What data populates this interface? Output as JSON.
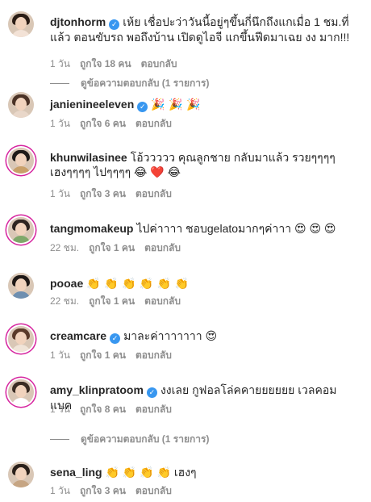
{
  "comments": [
    {
      "username": "djtonhorm",
      "verified": true,
      "text": "เห้ย เชื่อปะว่าวันนี้อยู่ๆขึ้นกี่นึกถึงแกเมื่อ 1 ชม.ที่แล้ว ตอนขับรถ พอถึงบ้าน เปิดดูไอจี แกขึ้นฟีดมาเฉย งง มาก!!!",
      "time": "1 วัน",
      "likes": "ถูกใจ 18 คน",
      "reply": "ตอบกลับ",
      "view_replies": "ดูข้อความตอบกลับ (1 รายการ)"
    },
    {
      "username": "janienineeleven",
      "verified": true,
      "text": "🎉 🎉 🎉",
      "time": "1 วัน",
      "likes": "ถูกใจ 6 คน",
      "reply": "ตอบกลับ"
    },
    {
      "username": "khunwilasinee",
      "verified": false,
      "text": "โอ้ววววว คุณลูกชาย กลับมาแล้ว รวยๆๆๆๆเฮงๆๆๆๆ ไปๆๆๆๆ 😂 ❤️ 😂",
      "time": "1 วัน",
      "likes": "ถูกใจ 3 คน",
      "reply": "ตอบกลับ"
    },
    {
      "username": "tangmomakeup",
      "verified": false,
      "text": "ไปค่าาาา ชอบgelatoมากๆค่าาา 😍 😍 😍",
      "time": "22 ชม.",
      "likes": "ถูกใจ 1 คน",
      "reply": "ตอบกลับ"
    },
    {
      "username": "pooae",
      "verified": false,
      "text": "👏 👏 👏 👏 👏 👏",
      "time": "22 ชม.",
      "likes": "ถูกใจ 1 คน",
      "reply": "ตอบกลับ"
    },
    {
      "username": "creamcare",
      "verified": true,
      "text": "มาละค่าาาาาาา 😍",
      "time": "1 วัน",
      "likes": "ถูกใจ 1 คน",
      "reply": "ตอบกลับ"
    },
    {
      "username": "amy_klinpratoom",
      "verified": true,
      "text": "งงเลย กูฟอลโล่คคายยยยยย เวลคอมแบค",
      "time": "1 วัน",
      "likes": "ถูกใจ 8 คน",
      "reply": "ตอบกลับ",
      "view_replies": "ดูข้อความตอบกลับ (1 รายการ)"
    },
    {
      "username": "sena_ling",
      "verified": false,
      "text": "👏 👏 👏 👏 เฮงๆ",
      "time": "1 วัน",
      "likes": "ถูกใจ 3 คน",
      "reply": "ตอบกลับ"
    }
  ],
  "colors": {
    "verified_badge": "#3897f0",
    "story_ring": "#d6249f",
    "meta_text": "#8e8e8e"
  },
  "icons": {
    "verified": "verified-badge-icon"
  }
}
